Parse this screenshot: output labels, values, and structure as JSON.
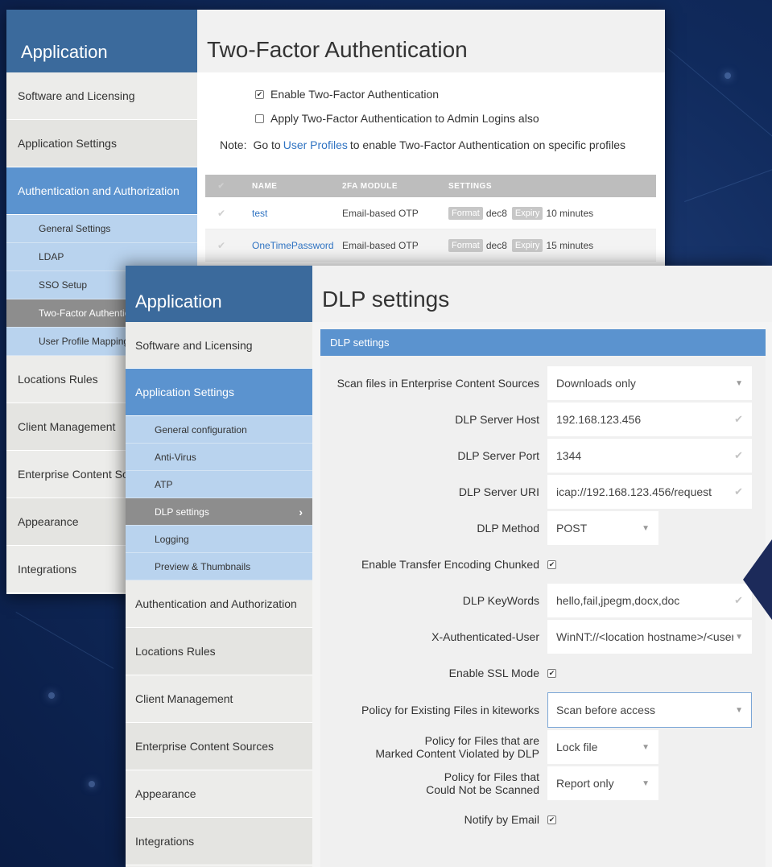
{
  "back_window": {
    "sidebar": {
      "title": "Application",
      "items": [
        {
          "label": "Software and Licensing"
        },
        {
          "label": "Application Settings"
        },
        {
          "label": "Authentication and Authorization"
        },
        {
          "label": "Locations Rules"
        },
        {
          "label": "Client Management"
        },
        {
          "label": "Enterprise Content Sources"
        },
        {
          "label": "Appearance"
        },
        {
          "label": "Integrations"
        }
      ],
      "sub_items": [
        {
          "label": "General Settings"
        },
        {
          "label": "LDAP"
        },
        {
          "label": "SSO Setup"
        },
        {
          "label": "Two-Factor Authentication"
        },
        {
          "label": "User Profile Mapping"
        }
      ]
    },
    "page_title": "Two-Factor Authentication",
    "enable_2fa": {
      "label": "Enable Two-Factor Authentication",
      "checked": true
    },
    "admin_2fa": {
      "label": "Apply Two-Factor Authentication to Admin Logins also",
      "checked": false
    },
    "note": {
      "prefix": "Note:",
      "before_link": "Go to",
      "link": "User Profiles",
      "after_link": "to enable Two-Factor Authentication on specific profiles"
    },
    "table": {
      "headers": [
        "NAME",
        "2FA MODULE",
        "SETTINGS"
      ],
      "rows": [
        {
          "name": "test",
          "module": "Email-based OTP",
          "format_tag": "Format",
          "format": "dec8",
          "expiry_tag": "Expiry",
          "expiry": "10 minutes"
        },
        {
          "name": "OneTimePassword",
          "module": "Email-based OTP",
          "format_tag": "Format",
          "format": "dec8",
          "expiry_tag": "Expiry",
          "expiry": "15 minutes"
        }
      ]
    }
  },
  "front_window": {
    "sidebar": {
      "title": "Application",
      "items_top": [
        {
          "label": "Software and Licensing"
        },
        {
          "label": "Application Settings"
        }
      ],
      "sub_items": [
        {
          "label": "General configuration"
        },
        {
          "label": "Anti-Virus"
        },
        {
          "label": "ATP"
        },
        {
          "label": "DLP settings"
        },
        {
          "label": "Logging"
        },
        {
          "label": "Preview & Thumbnails"
        }
      ],
      "items_bottom": [
        {
          "label": "Authentication and Authorization"
        },
        {
          "label": "Locations Rules"
        },
        {
          "label": "Client Management"
        },
        {
          "label": "Enterprise Content Sources"
        },
        {
          "label": "Appearance"
        },
        {
          "label": "Integrations"
        }
      ]
    },
    "page_title": "DLP settings",
    "panel_title": "DLP settings",
    "form": {
      "scan_files": {
        "label": "Scan files in Enterprise Content Sources",
        "value": "Downloads only"
      },
      "server_host": {
        "label": "DLP Server Host",
        "value": "192.168.123.456"
      },
      "server_port": {
        "label": "DLP Server Port",
        "value": "1344"
      },
      "server_uri": {
        "label": "DLP Server URI",
        "value": "icap://192.168.123.456/request"
      },
      "method": {
        "label": "DLP Method",
        "value": "POST"
      },
      "chunked": {
        "label": "Enable Transfer Encoding Chunked",
        "checked": true
      },
      "keywords": {
        "label": "DLP KeyWords",
        "value": "hello,fail,jpegm,docx,doc"
      },
      "auth_user": {
        "label": "X-Authenticated-User",
        "value": "WinNT://<location hostname>/<user"
      },
      "ssl": {
        "label": "Enable SSL Mode",
        "checked": true
      },
      "existing_files": {
        "label": "Policy for Existing Files in kiteworks",
        "value": "Scan before access"
      },
      "violated": {
        "label_line1": "Policy for Files that are",
        "label_line2": "Marked Content Violated by DLP",
        "value": "Lock file"
      },
      "not_scanned": {
        "label_line1": "Policy for Files that",
        "label_line2": "Could Not be Scanned",
        "value": "Report only"
      },
      "notify": {
        "label": "Notify by Email",
        "checked": true
      }
    }
  },
  "colors": {
    "sidebar_header": "#3b6a9c",
    "active_nav": "#5b93cf",
    "sub_nav": "#b9d3ee",
    "selected_sub": "#8d8d8d",
    "link": "#2f73c2"
  }
}
